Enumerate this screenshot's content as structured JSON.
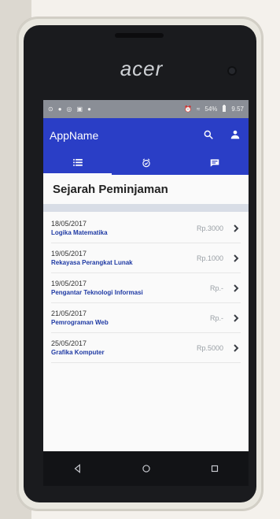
{
  "device": {
    "brand": "acer"
  },
  "status_bar": {
    "icons": [
      "⊙",
      "●",
      "◎",
      "▣",
      "●"
    ],
    "alarm_icon": "⏰",
    "wifi_icon": "≈",
    "battery_text": "54%",
    "time": "9.57"
  },
  "app_bar": {
    "title": "AppName",
    "actions": [
      {
        "icon": "search-icon"
      },
      {
        "icon": "person-icon"
      }
    ]
  },
  "tabs": [
    {
      "icon": "list-icon",
      "active": true
    },
    {
      "icon": "alarm-icon",
      "active": false
    },
    {
      "icon": "chat-icon",
      "active": false
    }
  ],
  "page": {
    "section_title": "Sejarah Peminjaman"
  },
  "list": {
    "items": [
      {
        "date": "18/05/2017",
        "title": "Logika Matematika",
        "amount": "Rp.3000"
      },
      {
        "date": "19/05/2017",
        "title": "Rekayasa Perangkat Lunak",
        "amount": "Rp.1000"
      },
      {
        "date": "19/05/2017",
        "title": "Pengantar Teknologi Informasi",
        "amount": "Rp.-"
      },
      {
        "date": "21/05/2017",
        "title": "Pemrograman Web",
        "amount": "Rp.-"
      },
      {
        "date": "25/05/2017",
        "title": "Grafika Komputer",
        "amount": "Rp.5000"
      }
    ]
  },
  "colors": {
    "primary": "#2a3ec6",
    "status_bg": "#8a8e96",
    "nav_bg": "#121316",
    "accent_text": "#1f3aa4"
  }
}
